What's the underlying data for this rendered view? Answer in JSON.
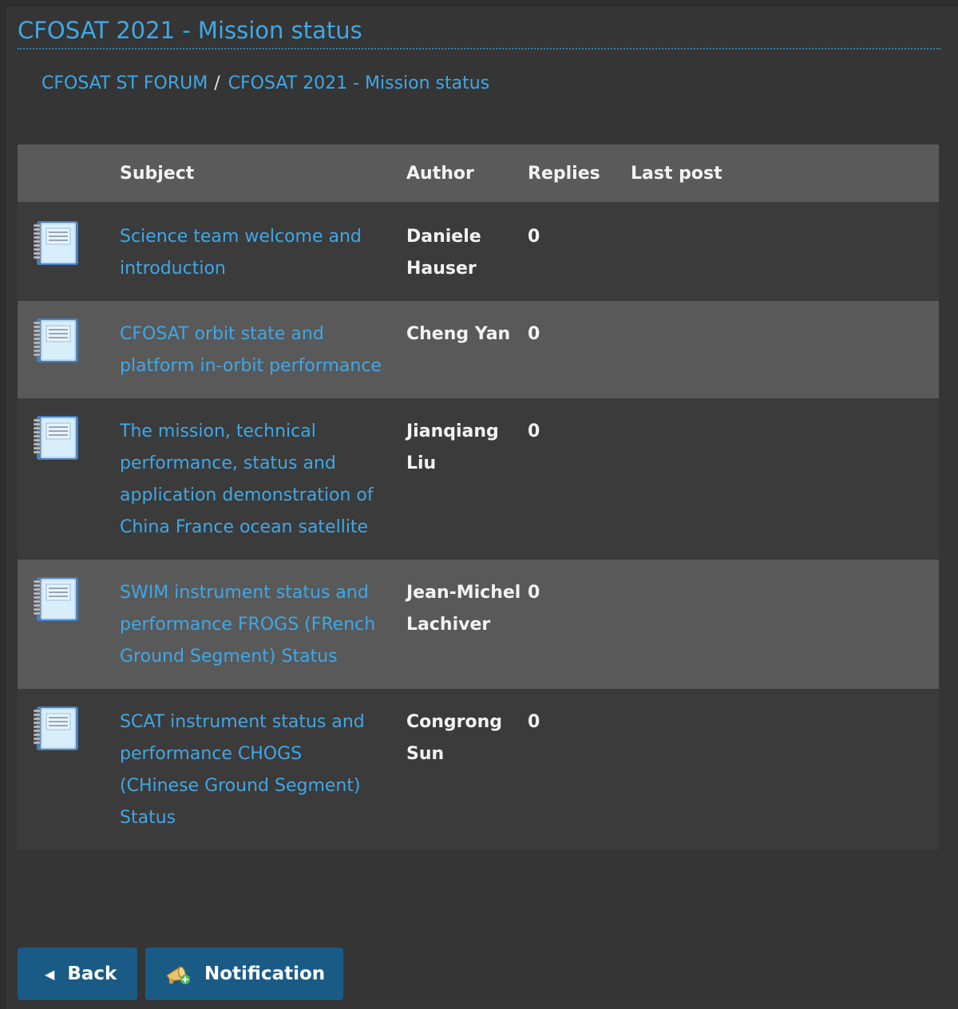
{
  "page": {
    "title": "CFOSAT 2021 - Mission status"
  },
  "breadcrumb": [
    {
      "label": "CFOSAT ST FORUM"
    },
    {
      "label": "CFOSAT 2021 - Mission status"
    }
  ],
  "breadcrumb_separator": "/",
  "table": {
    "headers": {
      "subject": "Subject",
      "author": "Author",
      "replies": "Replies",
      "last_post": "Last post"
    },
    "rows": [
      {
        "subject": "Science team welcome and introduction",
        "author": "Daniele Hauser",
        "replies": "0",
        "last_post": ""
      },
      {
        "subject": "CFOSAT orbit state and platform in-orbit performance",
        "author": "Cheng Yan",
        "replies": "0",
        "last_post": ""
      },
      {
        "subject": "The mission, technical performance,  status and application demonstration of China France ocean satellite",
        "author": "Jianqiang Liu",
        "replies": "0",
        "last_post": ""
      },
      {
        "subject": "SWIM instrument status and performance FROGS (FRench Ground Segment) Status",
        "author": "Jean-Michel Lachiver",
        "replies": "0",
        "last_post": ""
      },
      {
        "subject": "SCAT instrument status and performance CHOGS (CHinese Ground Segment) Status",
        "author": "Congrong Sun",
        "replies": "0",
        "last_post": ""
      }
    ]
  },
  "buttons": {
    "back": "Back",
    "notification": "Notification"
  },
  "icons": {
    "topic": "notebook-icon",
    "back": "caret-left-icon",
    "notification": "horn-plus-icon"
  },
  "colors": {
    "link": "#3fa8e6",
    "button": "#1a5b86",
    "header_bg": "#5a5a5a",
    "row_dark": "#3b3b3b",
    "row_light": "#595959"
  }
}
